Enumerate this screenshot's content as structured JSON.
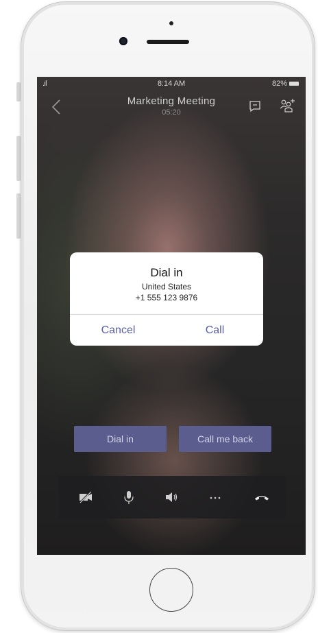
{
  "status_bar": {
    "signal": ".ıl",
    "time": "8:14 AM",
    "battery": "82%"
  },
  "header": {
    "title": "Marketing Meeting",
    "timer": "05:20",
    "icons": [
      "back-icon",
      "chat-icon",
      "add-people-icon"
    ]
  },
  "dialog": {
    "title": "Dial in",
    "country": "United States",
    "number": "+1 555 123 9876",
    "cancel_label": "Cancel",
    "call_label": "Call"
  },
  "actions": {
    "dial_in_label": "Dial in",
    "call_me_back_label": "Call me back"
  },
  "toolbar": {
    "icons": [
      "video-off-icon",
      "microphone-icon",
      "speaker-icon",
      "more-icon",
      "hang-up-icon"
    ]
  },
  "colors": {
    "accent": "#5b5ea6",
    "action_button_bg": "#5b5d8f"
  }
}
